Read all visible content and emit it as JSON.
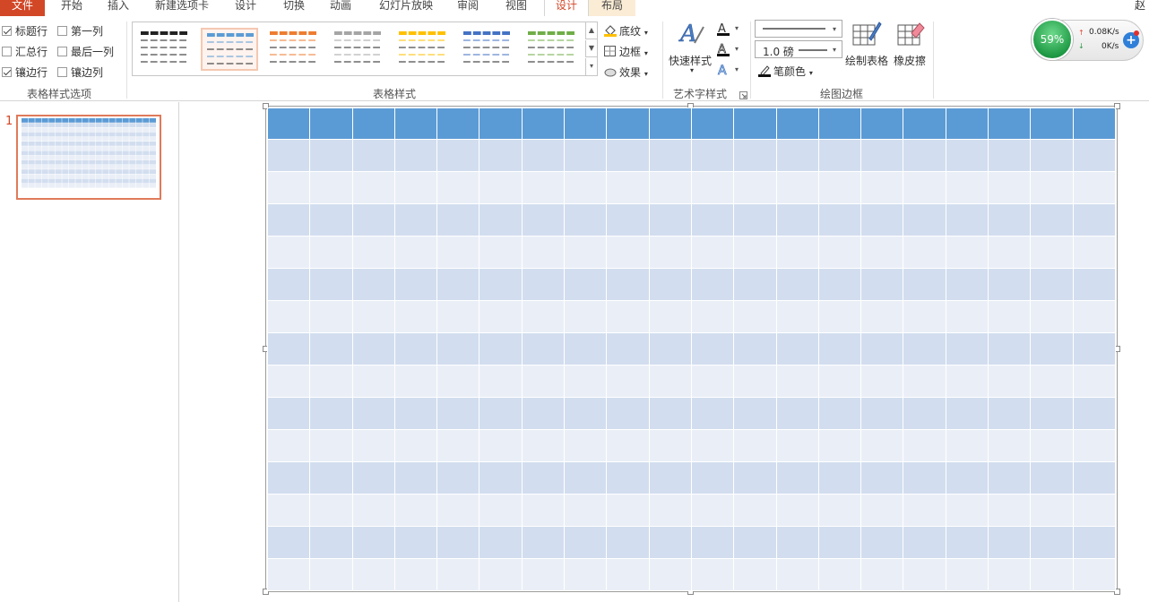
{
  "tabs": [
    {
      "label": "文件"
    },
    {
      "label": "开始"
    },
    {
      "label": "插入"
    },
    {
      "label": "新建选项卡"
    },
    {
      "label": "设计"
    },
    {
      "label": "切换"
    },
    {
      "label": "动画"
    },
    {
      "label": "幻灯片放映"
    },
    {
      "label": "审阅"
    },
    {
      "label": "视图"
    },
    {
      "label": "设计"
    },
    {
      "label": "布局"
    }
  ],
  "user_initial": "赵",
  "options": {
    "group_label": "表格样式选项",
    "header_row": "标题行",
    "first_column": "第一列",
    "total_row": "汇总行",
    "last_column": "最后一列",
    "banded_rows": "镶边行",
    "banded_columns": "镶边列",
    "checked": {
      "header_row": true,
      "first_column": false,
      "total_row": false,
      "last_column": false,
      "banded_rows": true,
      "banded_columns": false
    }
  },
  "styles": {
    "group_label": "表格样式",
    "thumb_colors": [
      "#222222",
      "#5b9bd5",
      "#ed7d31",
      "#a5a5a5",
      "#ffc000",
      "#4472c4",
      "#70ad47"
    ],
    "shading": "底纹",
    "border": "边框",
    "effects": "效果"
  },
  "wordart": {
    "group_label": "艺术字样式",
    "quick_styles": "快速样式"
  },
  "draw_borders": {
    "group_label": "绘图边框",
    "pen_weight": "1.0 磅",
    "pen_color": "笔颜色",
    "draw_table": "绘制表格",
    "eraser": "橡皮擦"
  },
  "network": {
    "percent": "59%",
    "up": "0.08K/s",
    "down": "0K/s"
  },
  "slides": {
    "number": "1"
  },
  "table": {
    "rows": 15,
    "cols": 20,
    "header_color": "#5b9bd5",
    "band1_color": "#d2deef",
    "band2_color": "#eaeff7"
  }
}
